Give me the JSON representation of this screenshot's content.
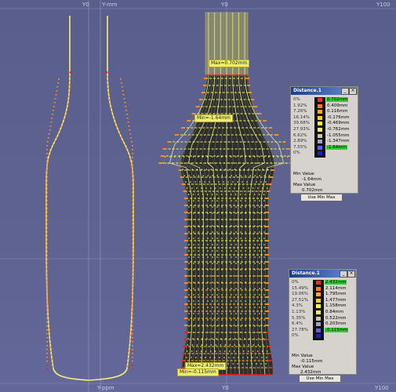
{
  "axis_labels": {
    "left_top_y0": "Y0",
    "left_top_y_small": "Y-mm",
    "mid_top_y0": "Y0",
    "top_right_y100": "Y100",
    "left_bottom_yrel": "Y-ppm",
    "mid_bottom_y0": "Y0",
    "bottom_right_y100": "Y100"
  },
  "tags": {
    "max_top": "Max=0.702mm",
    "min_top": "Min=-1.64mm",
    "max_bottom": "Max=2.432mm",
    "min_bottom": "Min=-0.115mm"
  },
  "panel1": {
    "title": "Distance.1",
    "rows": [
      {
        "pct": "0%",
        "value": "0.702mm",
        "color": "#ff2a1a",
        "highlight": true
      },
      {
        "pct": "1.92%",
        "value": "0.409mm",
        "color": "#ff7a1a",
        "highlight": false
      },
      {
        "pct": "7.26%",
        "value": "0.116mm",
        "color": "#ffaa1a",
        "highlight": false
      },
      {
        "pct": "16.14%",
        "value": "-0.176mm",
        "color": "#ffd21a",
        "highlight": false
      },
      {
        "pct": "39.68%",
        "value": "-0.469mm",
        "color": "#ffff30",
        "highlight": false
      },
      {
        "pct": "27.93%",
        "value": "-0.762mm",
        "color": "#f0f060",
        "highlight": false
      },
      {
        "pct": "6.62%",
        "value": "-1.055mm",
        "color": "#c8c8a0",
        "highlight": false
      },
      {
        "pct": "2.89%",
        "value": "-1.347mm",
        "color": "#a0a0c8",
        "highlight": false
      },
      {
        "pct": "7.55%",
        "value": "-1.64mm",
        "color": "#6060ff",
        "highlight": true
      },
      {
        "pct": "0%",
        "value": "",
        "color": "#2020c0",
        "highlight": false
      }
    ],
    "min_label": "Min Value",
    "min_value": "-1.64mm",
    "max_label": "Max Value",
    "max_value": "0.702mm",
    "button": "Use Min Max"
  },
  "panel2": {
    "title": "Distance.1",
    "rows": [
      {
        "pct": "0%",
        "value": "2.432mm",
        "color": "#ff2a1a",
        "highlight": true
      },
      {
        "pct": "15.49%",
        "value": "2.114mm",
        "color": "#ff7a1a",
        "highlight": false
      },
      {
        "pct": "19.06%",
        "value": "1.795mm",
        "color": "#ffaa1a",
        "highlight": false
      },
      {
        "pct": "27.51%",
        "value": "1.477mm",
        "color": "#ffd21a",
        "highlight": false
      },
      {
        "pct": "4.3%",
        "value": "1.158mm",
        "color": "#ffff30",
        "highlight": false
      },
      {
        "pct": "1.13%",
        "value": "0.84mm",
        "color": "#f0f060",
        "highlight": false
      },
      {
        "pct": "5.35%",
        "value": "0.522mm",
        "color": "#c8c8a0",
        "highlight": false
      },
      {
        "pct": "6.4%",
        "value": "0.203mm",
        "color": "#a0a0c8",
        "highlight": false
      },
      {
        "pct": "27.78%",
        "value": "-0.115mm",
        "color": "#6060ff",
        "highlight": true
      },
      {
        "pct": "0%",
        "value": "",
        "color": "#2020c0",
        "highlight": false
      }
    ],
    "min_label": "Min Value",
    "min_value": "-0.115mm",
    "max_label": "Max Value",
    "max_value": "2.432mm",
    "button": "Use Min Max"
  },
  "colors": {
    "background": "#5b5f8e",
    "mesh": "#f2f060",
    "mesh_dark": "#2e3030",
    "profile_red": "#e82020",
    "profile_orange": "#ff9a20",
    "profile_yellow": "#f8f070"
  }
}
